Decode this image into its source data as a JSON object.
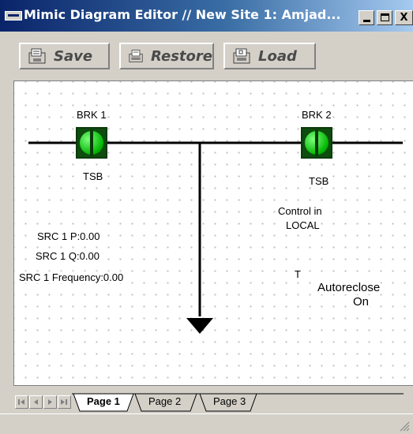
{
  "window": {
    "title": "Mimic Diagram Editor // New Site 1: Amjad...",
    "controls": {
      "minimize": "_",
      "maximize": "□",
      "close": "X"
    }
  },
  "toolbar": {
    "save_label": "Save",
    "restore_label": "Restore",
    "load_label": "Load",
    "save_icon": "save-disk-icon",
    "restore_icon": "restore-folder-icon",
    "load_icon": "load-folder-icon"
  },
  "diagram": {
    "breaker1": {
      "name": "BRK 1",
      "tag": "TSB",
      "state_color": "#00b400"
    },
    "breaker2": {
      "name": "BRK 2",
      "tag": "TSB",
      "state_color": "#00b400"
    },
    "control_line1": "Control in",
    "control_line2": "LOCAL",
    "src_p": "SRC 1 P:0.00",
    "src_q": "SRC 1 Q:0.00",
    "src_freq": "SRC 1 Frequency:0.00",
    "t_label": "T",
    "autoreclose_line1": "Autoreclose",
    "autoreclose_line2": "On"
  },
  "tabs": {
    "items": [
      "Page 1",
      "Page 2",
      "Page 3"
    ],
    "active": "Page 1"
  }
}
